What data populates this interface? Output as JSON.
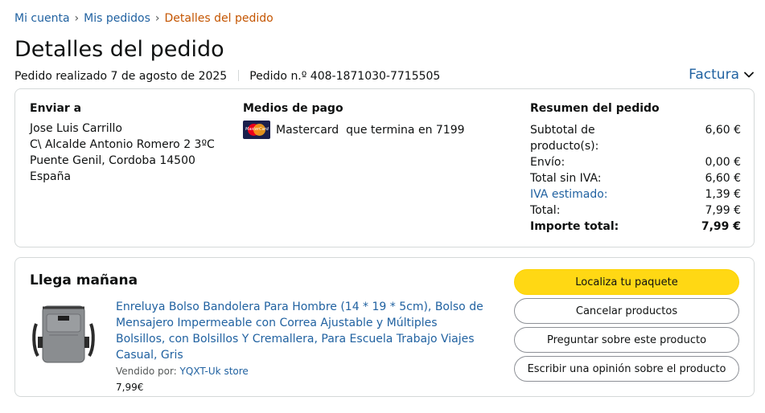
{
  "breadcrumb": {
    "items": [
      "Mi cuenta",
      "Mis pedidos"
    ],
    "separator": "›",
    "current": "Detalles del pedido"
  },
  "page_title": "Detalles del pedido",
  "order_meta": {
    "placed": "Pedido realizado 7 de agosto de 2025",
    "number": "Pedido n.º 408-1871030-7715505"
  },
  "invoice_label": "Factura",
  "shipping": {
    "title": "Enviar a",
    "lines": [
      "Jose Luis Carrillo",
      "C\\ Alcalde Antonio Romero 2 3ºC",
      "Puente Genil, Cordoba 14500",
      "España"
    ]
  },
  "payment": {
    "title": "Medios de pago",
    "logo_text": "MasterCard",
    "method": "Mastercard",
    "ending": "que termina en 7199"
  },
  "summary": {
    "title": "Resumen del pedido",
    "rows": [
      {
        "label": "Subtotal de producto(s):",
        "value": "6,60 €"
      },
      {
        "label": "Envío:",
        "value": "0,00 €"
      },
      {
        "label": "Total sin IVA:",
        "value": "6,60 €"
      },
      {
        "label": "IVA estimado:",
        "value": "1,39 €"
      },
      {
        "label": "Total:",
        "value": "7,99 €"
      },
      {
        "label": "Importe total:",
        "value": "7,99 €"
      }
    ]
  },
  "shipment": {
    "status": "Llega mañana",
    "product": {
      "image_alt": "bag-product-image",
      "title": "Enreluya Bolso Bandolera Para Hombre (14 * 19 * 5cm), Bolso de Mensajero Impermeable con Correa Ajustable y Múltiples Bolsillos, con Bolsillos Y Cremallera, Para Escuela Trabajo Viajes Casual, Gris",
      "sold_by_label": "Vendido por:",
      "seller": "YQXT-Uk store",
      "price": "7,99€"
    },
    "buttons": {
      "track": "Localiza tu paquete",
      "cancel": "Cancelar productos",
      "ask": "Preguntar sobre este producto",
      "review": "Escribir una opinión sobre el producto"
    }
  },
  "colors": {
    "link": "#2162a1",
    "breadcrumb_current": "#c45500",
    "primary_button": "#ffd814",
    "border": "#d5d9d9"
  },
  "icons": {
    "invoice_dropdown": "chevron-down-icon",
    "payment_card": "mastercard-logo"
  }
}
